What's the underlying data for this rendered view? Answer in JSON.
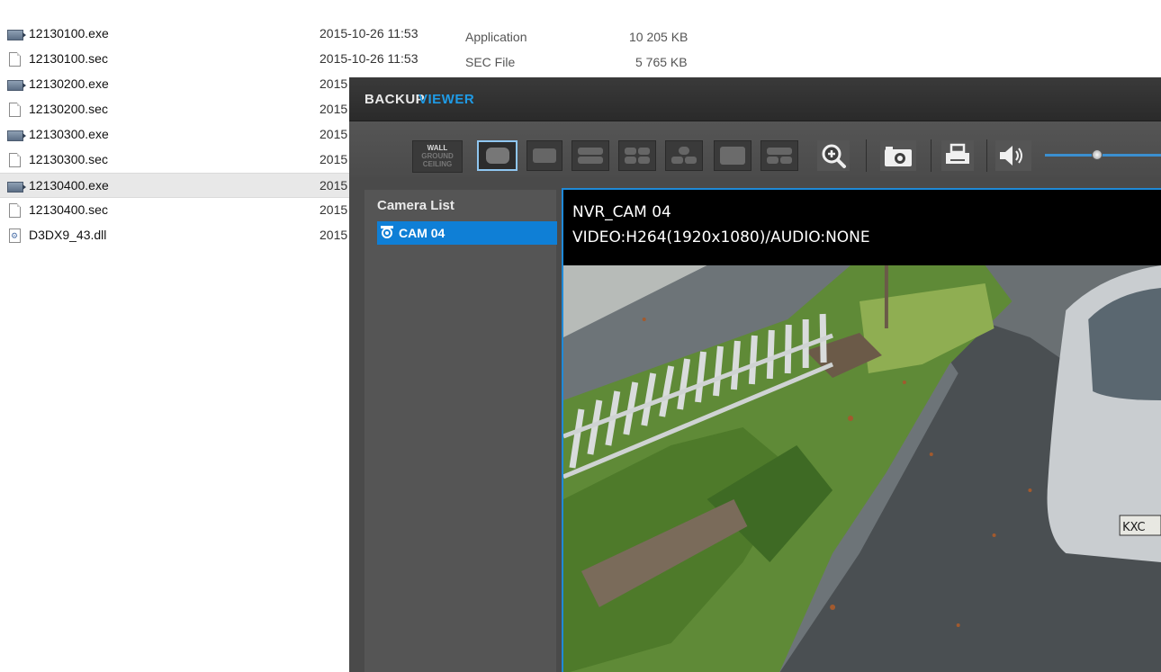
{
  "files": [
    {
      "name": "12130100.exe",
      "type": "exe",
      "date": "2015-10-26 11:53"
    },
    {
      "name": "12130100.sec",
      "type": "sec",
      "date": "2015-10-26 11:53"
    },
    {
      "name": "12130200.exe",
      "type": "exe",
      "date": "2015"
    },
    {
      "name": "12130200.sec",
      "type": "sec",
      "date": "2015"
    },
    {
      "name": "12130300.exe",
      "type": "exe",
      "date": "2015"
    },
    {
      "name": "12130300.sec",
      "type": "sec",
      "date": "2015"
    },
    {
      "name": "12130400.exe",
      "type": "exe",
      "date": "2015",
      "selected": true
    },
    {
      "name": "12130400.sec",
      "type": "sec",
      "date": "2015"
    },
    {
      "name": "D3DX9_43.dll",
      "type": "dll",
      "date": "2015"
    }
  ],
  "file_details": [
    {
      "type_label": "Application",
      "size": "10 205 KB"
    },
    {
      "type_label": "SEC File",
      "size": "5 765 KB"
    }
  ],
  "viewer": {
    "title_main": "BACKUP",
    "title_accent": "VIEWER",
    "mode_label": {
      "line1": "WALL",
      "line2": "GROUND",
      "line3": "CEILING"
    },
    "camera_list_title": "Camera List",
    "camera_item": "CAM 04",
    "video_cam_name": "NVR_CAM 04",
    "video_codec": "VIDEO:H264(1920x1080)/AUDIO:NONE",
    "volume_level_fraction": 0.45,
    "accent_color": "#1f9be6",
    "selection_color": "#0f7fd6",
    "icons": [
      "zoom-in-icon",
      "snapshot-camera-icon",
      "print-icon",
      "speaker-icon",
      "camera-item-icon"
    ],
    "plate_text": "KXC"
  }
}
